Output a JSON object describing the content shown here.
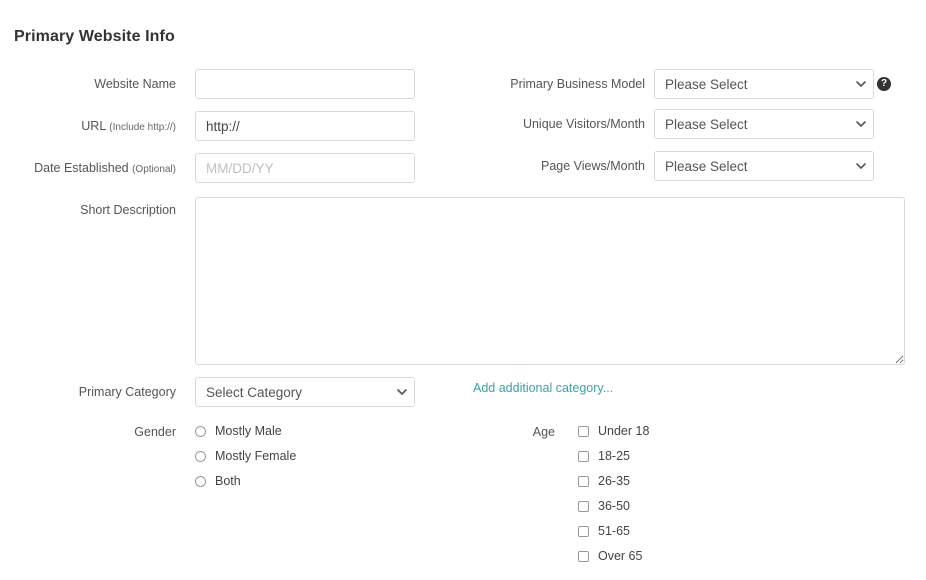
{
  "header": {
    "title": "Primary Website Info"
  },
  "left_column": {
    "website_name": {
      "label": "Website Name",
      "value": "",
      "placeholder": ""
    },
    "url": {
      "label": "URL",
      "label_note": "(Include http://)",
      "value": "http://",
      "placeholder": ""
    },
    "date_established": {
      "label": "Date Established",
      "label_note": "(Optional)",
      "value": "",
      "placeholder": "MM/DD/YY"
    },
    "short_description": {
      "label": "Short Description",
      "value": "",
      "placeholder": ""
    },
    "primary_category": {
      "label": "Primary Category",
      "selected": "Select Category",
      "options": [
        "Select Category"
      ]
    }
  },
  "right_column": {
    "primary_business_model": {
      "label": "Primary Business Model",
      "selected": "Please Select",
      "options": [
        "Please Select"
      ],
      "help_icon_glyph": "?"
    },
    "unique_visitors": {
      "label": "Unique Visitors/Month",
      "selected": "Please Select",
      "options": [
        "Please Select"
      ]
    },
    "page_views": {
      "label": "Page Views/Month",
      "selected": "Please Select",
      "options": [
        "Please Select"
      ]
    },
    "add_category_link": "Add additional category..."
  },
  "gender": {
    "label": "Gender",
    "options": [
      {
        "label": "Mostly Male",
        "selected": false
      },
      {
        "label": "Mostly Female",
        "selected": false
      },
      {
        "label": "Both",
        "selected": false
      }
    ]
  },
  "age": {
    "label": "Age",
    "options": [
      {
        "label": "Under 18",
        "checked": false
      },
      {
        "label": "18-25",
        "checked": false
      },
      {
        "label": "26-35",
        "checked": false
      },
      {
        "label": "36-50",
        "checked": false
      },
      {
        "label": "51-65",
        "checked": false
      },
      {
        "label": "Over 65",
        "checked": false
      }
    ]
  },
  "colors": {
    "title": "#333333",
    "label": "#555555",
    "border": "#d8d8d8",
    "link": "#3ba3aa",
    "placeholder": "#bfbfbf",
    "help_icon_bg": "#333333"
  }
}
